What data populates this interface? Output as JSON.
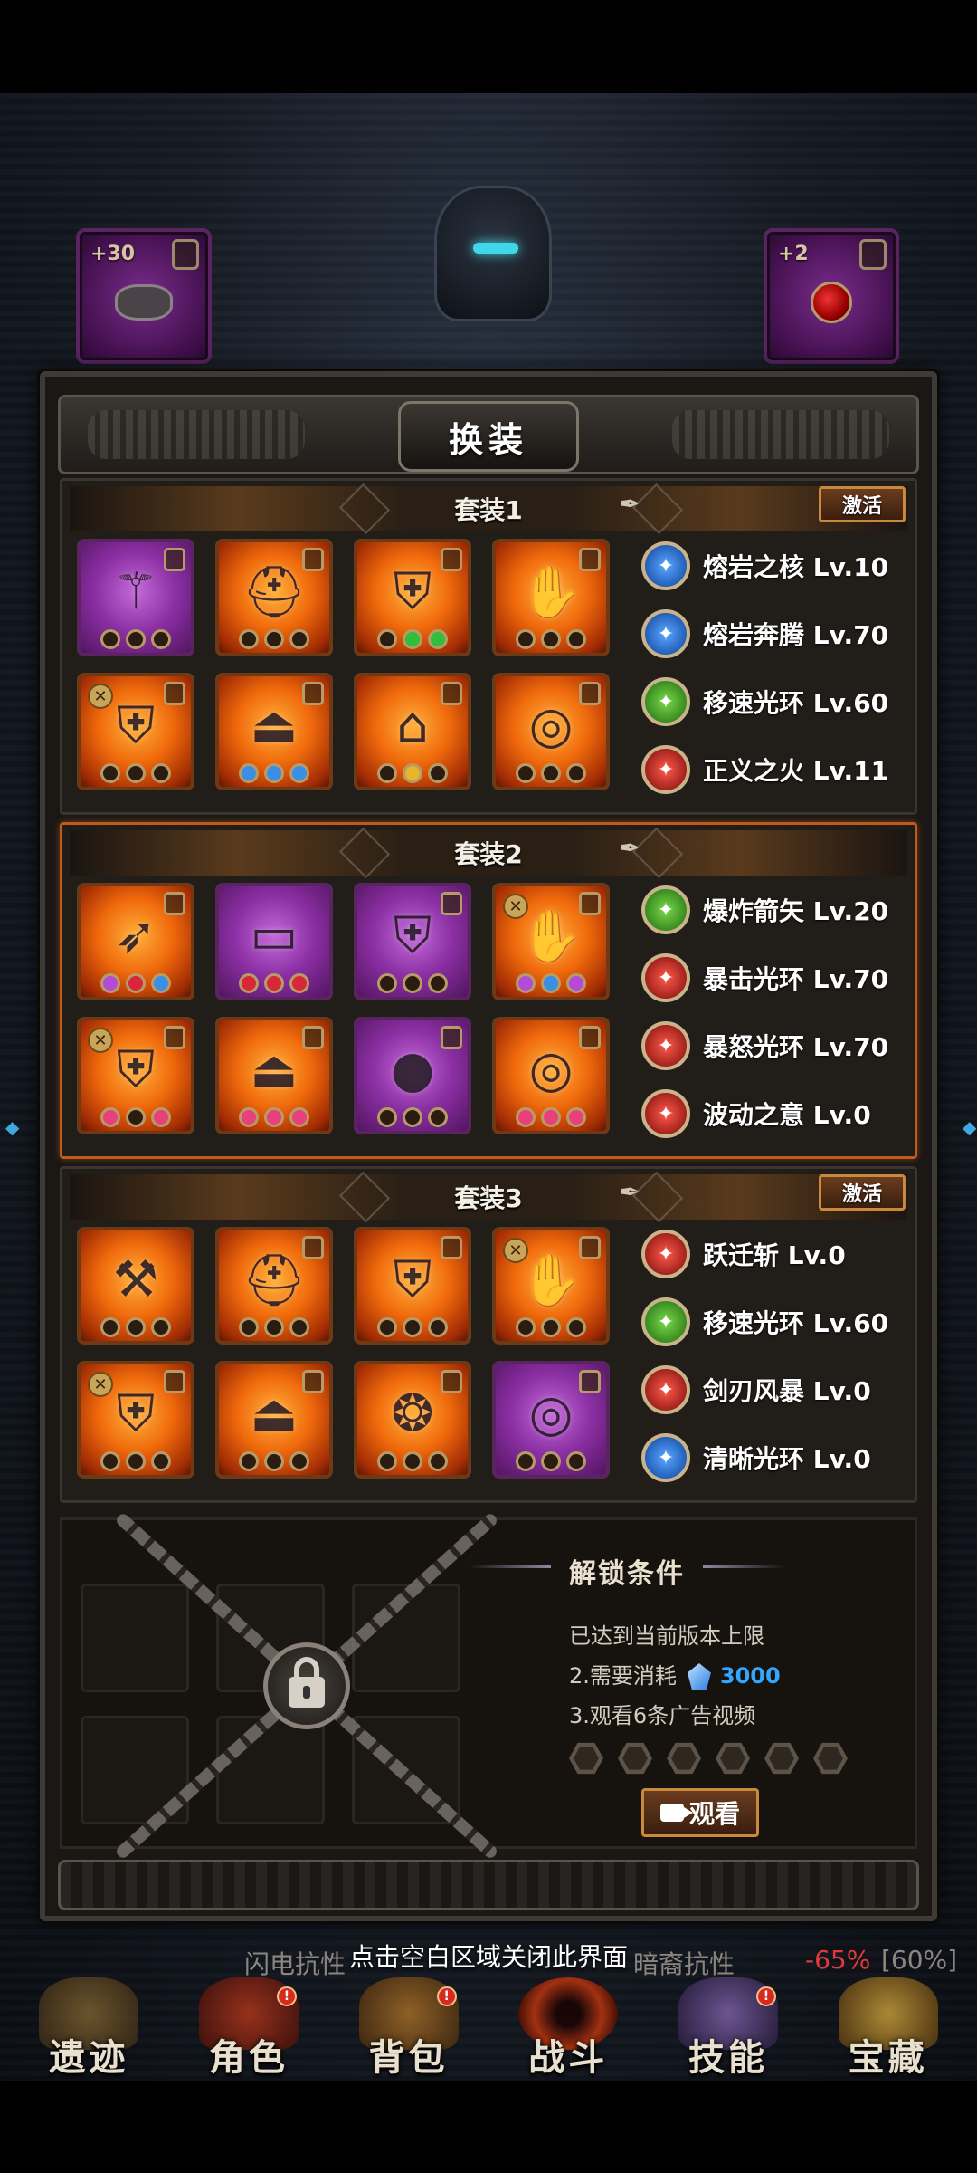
{
  "panel": {
    "title": "换装"
  },
  "top_slots": [
    {
      "badge": "+30",
      "color": "purple",
      "icon": "helmet-piece-icon"
    },
    {
      "badge": "+2",
      "color": "purple",
      "icon": "red-orb-icon"
    }
  ],
  "sets": [
    {
      "name": "套装1",
      "activate_label": "激活",
      "active": false,
      "items": [
        {
          "rarity": "purple",
          "icon": "staff-icon",
          "lock": true,
          "x": false,
          "sockets": [
            "",
            "",
            ""
          ]
        },
        {
          "rarity": "orange",
          "icon": "helmet-icon",
          "lock": true,
          "x": false,
          "sockets": [
            "",
            "",
            ""
          ]
        },
        {
          "rarity": "orange",
          "icon": "armor-icon",
          "lock": true,
          "x": false,
          "sockets": [
            "",
            "g",
            "g"
          ]
        },
        {
          "rarity": "orange",
          "icon": "gauntlet-icon",
          "lock": true,
          "x": false,
          "sockets": [
            "",
            "",
            ""
          ]
        },
        {
          "rarity": "orange",
          "icon": "chest-icon",
          "lock": true,
          "x": true,
          "sockets": [
            "",
            "",
            ""
          ]
        },
        {
          "rarity": "orange",
          "icon": "boots-icon",
          "lock": true,
          "x": false,
          "sockets": [
            "b",
            "b",
            "b"
          ]
        },
        {
          "rarity": "orange",
          "icon": "shoulder-icon",
          "lock": true,
          "x": false,
          "sockets": [
            "",
            "y",
            ""
          ]
        },
        {
          "rarity": "orange",
          "icon": "ring-icon",
          "lock": true,
          "x": false,
          "sockets": [
            "",
            "",
            ""
          ]
        }
      ],
      "skills": [
        {
          "name": "熔岩之核 Lv.10",
          "color": "blue",
          "icon": "lava-core-icon"
        },
        {
          "name": "熔岩奔腾 Lv.70",
          "color": "blue",
          "icon": "lava-surge-icon"
        },
        {
          "name": "移速光环 Lv.60",
          "color": "green",
          "icon": "speed-aura-icon"
        },
        {
          "name": "正义之火 Lv.11",
          "color": "red",
          "icon": "justice-fire-icon"
        }
      ]
    },
    {
      "name": "套装2",
      "activate_label": "",
      "active": true,
      "items": [
        {
          "rarity": "orange",
          "icon": "bow-icon",
          "lock": true,
          "x": false,
          "sockets": [
            "p",
            "r",
            "b"
          ]
        },
        {
          "rarity": "purple",
          "icon": "belt-icon",
          "lock": false,
          "x": false,
          "sockets": [
            "r",
            "r",
            "r"
          ]
        },
        {
          "rarity": "purple",
          "icon": "coat-icon",
          "lock": true,
          "x": false,
          "sockets": [
            "",
            "",
            ""
          ]
        },
        {
          "rarity": "orange",
          "icon": "glove-icon",
          "lock": true,
          "x": true,
          "sockets": [
            "p",
            "b",
            "p"
          ]
        },
        {
          "rarity": "orange",
          "icon": "chest-icon",
          "lock": true,
          "x": true,
          "sockets": [
            "pk",
            "",
            "pk"
          ]
        },
        {
          "rarity": "orange",
          "icon": "boots-icon",
          "lock": true,
          "x": false,
          "sockets": [
            "pk",
            "pk",
            "pk"
          ]
        },
        {
          "rarity": "purple",
          "icon": "red-orb-icon",
          "lock": true,
          "x": false,
          "sockets": [
            "",
            "",
            ""
          ]
        },
        {
          "rarity": "orange",
          "icon": "ring-icon",
          "lock": true,
          "x": false,
          "sockets": [
            "pk",
            "pk",
            "pk"
          ]
        }
      ],
      "skills": [
        {
          "name": "爆炸箭矢 Lv.20",
          "color": "green",
          "icon": "explosive-arrow-icon"
        },
        {
          "name": "暴击光环 Lv.70",
          "color": "red",
          "icon": "crit-aura-icon"
        },
        {
          "name": "暴怒光环 Lv.70",
          "color": "red",
          "icon": "rage-aura-icon"
        },
        {
          "name": "波动之意 Lv.0",
          "color": "red",
          "icon": "wave-will-icon"
        }
      ]
    },
    {
      "name": "套装3",
      "activate_label": "激活",
      "active": false,
      "items": [
        {
          "rarity": "orange",
          "icon": "hammer-icon",
          "lock": false,
          "x": false,
          "sockets": [
            "",
            "",
            ""
          ]
        },
        {
          "rarity": "orange",
          "icon": "helmet-icon",
          "lock": true,
          "x": false,
          "sockets": [
            "",
            "",
            ""
          ]
        },
        {
          "rarity": "orange",
          "icon": "armor-icon",
          "lock": true,
          "x": false,
          "sockets": [
            "",
            "",
            ""
          ]
        },
        {
          "rarity": "orange",
          "icon": "glove-icon",
          "lock": true,
          "x": true,
          "sockets": [
            "",
            "",
            ""
          ]
        },
        {
          "rarity": "orange",
          "icon": "chest-icon",
          "lock": true,
          "x": true,
          "sockets": [
            "",
            "",
            ""
          ]
        },
        {
          "rarity": "orange",
          "icon": "boots-icon",
          "lock": true,
          "x": false,
          "sockets": [
            "",
            "",
            ""
          ]
        },
        {
          "rarity": "orange",
          "icon": "amulet-icon",
          "lock": true,
          "x": false,
          "sockets": [
            "",
            "",
            ""
          ]
        },
        {
          "rarity": "purple",
          "icon": "ring-icon",
          "lock": true,
          "x": false,
          "sockets": [
            "",
            "",
            ""
          ]
        }
      ],
      "skills": [
        {
          "name": "跃迁斩 Lv.0",
          "color": "red",
          "icon": "leap-slash-icon"
        },
        {
          "name": "移速光环 Lv.60",
          "color": "green",
          "icon": "speed-aura-icon"
        },
        {
          "name": "剑刃风暴 Lv.0",
          "color": "red",
          "icon": "blade-storm-icon"
        },
        {
          "name": "清晰光环 Lv.0",
          "color": "blue",
          "icon": "clarity-aura-icon"
        }
      ]
    }
  ],
  "unlock": {
    "title": "解锁条件",
    "cond1": "已达到当前版本上限",
    "cond2": "2.需要消耗",
    "cost": "3000",
    "cond3": "3.观看6条广告视频",
    "ads_watched": 0,
    "ads_total": 6,
    "watch_label": "观看"
  },
  "close_hint": "点击空白区域关闭此界面",
  "behind": {
    "t1": "闪电抗性",
    "t2": "暗裔抗性",
    "v1": "-65%",
    "v2": "[60%]"
  },
  "nav": [
    {
      "label": "遗迹",
      "icon": "relic-icon",
      "dot": false
    },
    {
      "label": "角色",
      "icon": "character-icon",
      "dot": true
    },
    {
      "label": "背包",
      "icon": "backpack-icon",
      "dot": true
    },
    {
      "label": "战斗",
      "icon": "battle-portal-icon",
      "dot": false
    },
    {
      "label": "技能",
      "icon": "skillbook-icon",
      "dot": true
    },
    {
      "label": "宝藏",
      "icon": "treasure-icon",
      "dot": false
    }
  ],
  "colors": {
    "orange_slot": "#f06a0c",
    "purple_slot": "#8a2fa3",
    "active_border": "#c25a1c",
    "cost": "#35a6ff"
  }
}
